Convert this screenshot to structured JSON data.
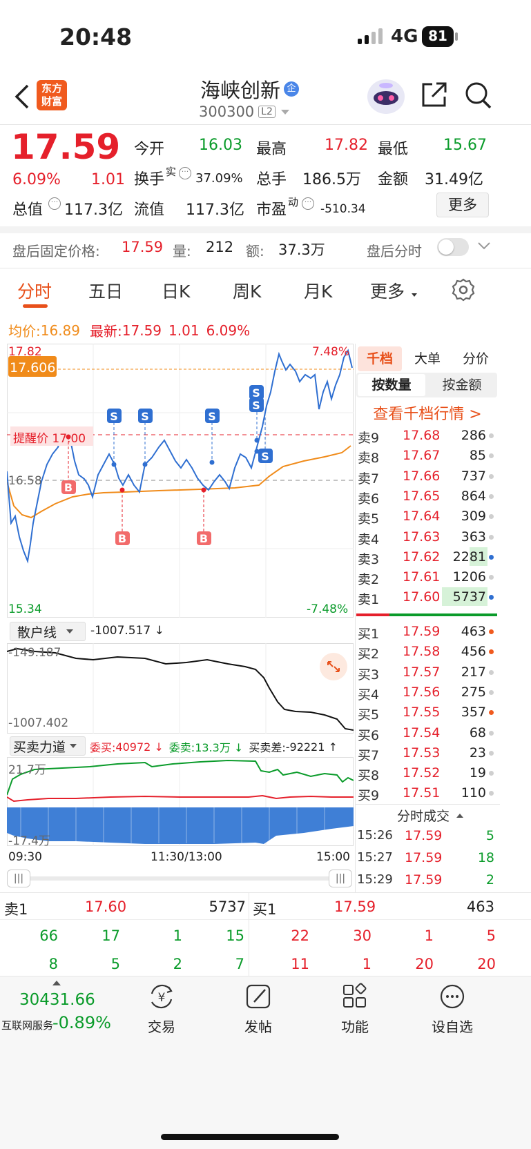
{
  "status": {
    "time": "20:48",
    "network": "4G",
    "battery": "81"
  },
  "header": {
    "back_icon": "chevron-left-icon",
    "logo_line1": "东方",
    "logo_line2": "财富",
    "stock_name": "海峡创新",
    "enterprise_badge": "企",
    "stock_code": "300300",
    "level_badge": "L2"
  },
  "quote": {
    "price": "17.59",
    "change_pct": "6.09%",
    "change_amt": "1.01",
    "open_label": "今开",
    "open": "16.03",
    "high_label": "最高",
    "high": "17.82",
    "low_label": "最低",
    "low": "15.67",
    "turnover_label": "换手",
    "turnover_sup": "实",
    "turnover": "37.09%",
    "volume_label": "总手",
    "volume": "186.5万",
    "amount_label": "金额",
    "amount": "31.49亿",
    "mktcap_label": "总值",
    "mktcap": "117.3亿",
    "float_label": "流值",
    "float_cap": "117.3亿",
    "pe_label": "市盈",
    "pe_sup": "动",
    "pe": "-510.34",
    "more_button": "更多"
  },
  "after_hours": {
    "fixed_label": "盘后固定价格:",
    "fixed_price": "17.59",
    "vol_label": "量:",
    "vol": "212",
    "amt_label": "额:",
    "amt": "37.3万",
    "toggle_label": "盘后分时"
  },
  "tabs": [
    "分时",
    "五日",
    "日K",
    "周K",
    "月K",
    "更多"
  ],
  "legend": {
    "avg_label": "均价:",
    "avg": "16.89",
    "last_label": "最新:",
    "last": "17.59",
    "chg": "1.01",
    "pct": "6.09%"
  },
  "intraday": {
    "y_top": "17.82",
    "price_marker": "17.606",
    "mid": "16.58",
    "y_bottom": "15.34",
    "pct_top": "7.48%",
    "pct_bottom": "-7.48%",
    "alert_label": "提醒价 17.00",
    "buy_marker": "B",
    "sell_marker": "S",
    "times": [
      "09:30",
      "11:30/13:00",
      "15:00"
    ]
  },
  "retail": {
    "name": "散户线",
    "value": "-1007.517 ↓",
    "top": "-149.187",
    "bottom": "-1007.402"
  },
  "force": {
    "name": "买卖力道",
    "bid_label": "委买:",
    "bid": "40972 ↓",
    "ask_label": "委卖:",
    "ask": "13.3万 ↓",
    "diff_label": "买卖差:",
    "diff": "-92221 ↑",
    "top": "21.7万",
    "bottom": "-17.4万"
  },
  "depth_tabs": [
    "千档",
    "大单",
    "分价"
  ],
  "depth_subtabs": [
    "按数量",
    "按金额"
  ],
  "depth_link": "查看千档行情 >",
  "asks": [
    {
      "l": "卖9",
      "p": "17.68",
      "v": "286"
    },
    {
      "l": "卖8",
      "p": "17.67",
      "v": "85"
    },
    {
      "l": "卖7",
      "p": "17.66",
      "v": "737"
    },
    {
      "l": "卖6",
      "p": "17.65",
      "v": "864"
    },
    {
      "l": "卖5",
      "p": "17.64",
      "v": "309"
    },
    {
      "l": "卖4",
      "p": "17.63",
      "v": "363"
    },
    {
      "l": "卖3",
      "p": "17.62",
      "v": "2281"
    },
    {
      "l": "卖2",
      "p": "17.61",
      "v": "1206"
    },
    {
      "l": "卖1",
      "p": "17.60",
      "v": "5737"
    }
  ],
  "bids": [
    {
      "l": "买1",
      "p": "17.59",
      "v": "463"
    },
    {
      "l": "买2",
      "p": "17.58",
      "v": "456"
    },
    {
      "l": "买3",
      "p": "17.57",
      "v": "217"
    },
    {
      "l": "买4",
      "p": "17.56",
      "v": "275"
    },
    {
      "l": "买5",
      "p": "17.55",
      "v": "357"
    },
    {
      "l": "买6",
      "p": "17.54",
      "v": "68"
    },
    {
      "l": "买7",
      "p": "17.53",
      "v": "23"
    },
    {
      "l": "买8",
      "p": "17.52",
      "v": "19"
    },
    {
      "l": "买9",
      "p": "17.51",
      "v": "110"
    }
  ],
  "trades_title": "分时成交",
  "trades": [
    {
      "t": "15:26",
      "p": "17.59",
      "v": "5"
    },
    {
      "t": "15:27",
      "p": "17.59",
      "v": "18"
    },
    {
      "t": "15:29",
      "p": "17.59",
      "v": "2"
    }
  ],
  "queue": {
    "ask_label": "卖1",
    "ask_price": "17.60",
    "ask_vol": "5737",
    "bid_label": "买1",
    "bid_price": "17.59",
    "bid_vol": "463",
    "ask_rows": [
      [
        "66",
        "17",
        "1",
        "15"
      ],
      [
        "8",
        "5",
        "2",
        "7"
      ]
    ],
    "bid_rows": [
      [
        "22",
        "30",
        "1",
        "5"
      ],
      [
        "11",
        "1",
        "20",
        "20"
      ]
    ]
  },
  "bottom": {
    "index_value": "30431.66",
    "index_name": "互联网服务",
    "index_pct": "-0.89%",
    "trade": "交易",
    "post": "发帖",
    "func": "功能",
    "watch": "设自选"
  },
  "colors": {
    "red": "#e5202b",
    "green": "#0a9b2a",
    "blue": "#2f6fd1",
    "orange": "#f08b1a",
    "accent": "#e8501a"
  }
}
